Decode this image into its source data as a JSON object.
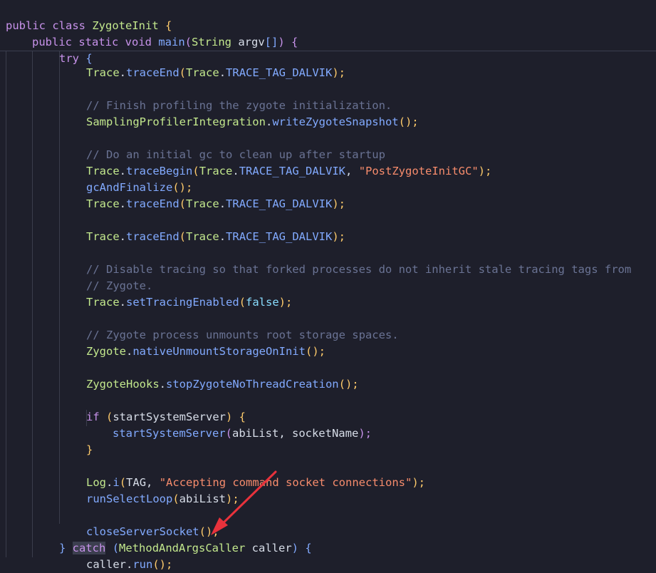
{
  "lines": {
    "l01": {
      "a": "public ",
      "b": "class ",
      "c": "ZygoteInit ",
      "d": "{"
    },
    "l02": {
      "a": "public ",
      "b": "static ",
      "c": "void ",
      "d": "main",
      "e": "(",
      "f": "String ",
      "g": "argv",
      "h": "[]",
      "i": ") ",
      "j": "{"
    },
    "l03": {
      "a": "try ",
      "b": "{"
    },
    "l04": {
      "a": "Trace",
      ".": ".",
      "b": "traceEnd",
      "c": "(",
      "d": "Trace",
      ".2": ".",
      "e": "TRACE_TAG_DALVIK",
      "f": ");"
    },
    "l05": {
      "a": "// Finish profiling the zygote initialization."
    },
    "l06": {
      "a": "SamplingProfilerIntegration",
      ".": ".",
      "b": "writeZygoteSnapshot",
      "c": "();"
    },
    "l07": {
      "a": "// Do an initial gc to clean up after startup"
    },
    "l08": {
      "a": "Trace",
      ".": ".",
      "b": "traceBegin",
      "c": "(",
      "d": "Trace",
      ".2": ".",
      "e": "TRACE_TAG_DALVIK",
      ",": ", ",
      "f": "\"PostZygoteInitGC\"",
      "g": ");"
    },
    "l09": {
      "a": "gcAndFinalize",
      "b": "();"
    },
    "l10": {
      "a": "Trace",
      ".": ".",
      "b": "traceEnd",
      "c": "(",
      "d": "Trace",
      ".2": ".",
      "e": "TRACE_TAG_DALVIK",
      "f": ");"
    },
    "l11": {
      "a": "Trace",
      ".": ".",
      "b": "traceEnd",
      "c": "(",
      "d": "Trace",
      ".2": ".",
      "e": "TRACE_TAG_DALVIK",
      "f": ");"
    },
    "l12": {
      "a": "// Disable tracing so that forked processes do not inherit stale tracing tags from"
    },
    "l13": {
      "a": "// Zygote."
    },
    "l14": {
      "a": "Trace",
      ".": ".",
      "b": "setTracingEnabled",
      "c": "(",
      "d": "false",
      "e": ");"
    },
    "l15": {
      "a": "// Zygote process unmounts root storage spaces."
    },
    "l16": {
      "a": "Zygote",
      ".": ".",
      "b": "nativeUnmountStorageOnInit",
      "c": "();"
    },
    "l17": {
      "a": "ZygoteHooks",
      ".": ".",
      "b": "stopZygoteNoThreadCreation",
      "c": "();"
    },
    "l18": {
      "a": "if ",
      "b": "(",
      "c": "startSystemServer",
      "d": ") ",
      "e": "{"
    },
    "l19": {
      "a": "startSystemServer",
      "b": "(",
      "c": "abiList",
      ",": ", ",
      "d": "socketName",
      "e": ");"
    },
    "l20": {
      "a": "}"
    },
    "l21": {
      "a": "Log",
      ".": ".",
      "b": "i",
      "c": "(",
      "d": "TAG",
      ",": ", ",
      "e": "\"Accepting command socket connections\"",
      "f": ");"
    },
    "l22": {
      "a": "runSelectLoop",
      "b": "(",
      "c": "abiList",
      "d": ");"
    },
    "l23": {
      "a": "closeServerSocket",
      "b": "();"
    },
    "l24": {
      "a": "} ",
      "b": "catch",
      " ": " ",
      "c": "(",
      "d": "MethodAndArgsCaller ",
      "e": "caller",
      "f": ") ",
      "g": "{"
    },
    "l25": {
      "a": "caller",
      ".": ".",
      "b": "run",
      "c": "();"
    }
  },
  "colors": {
    "background": "#1e1f2b",
    "annotation_arrow": "#e8323c"
  }
}
